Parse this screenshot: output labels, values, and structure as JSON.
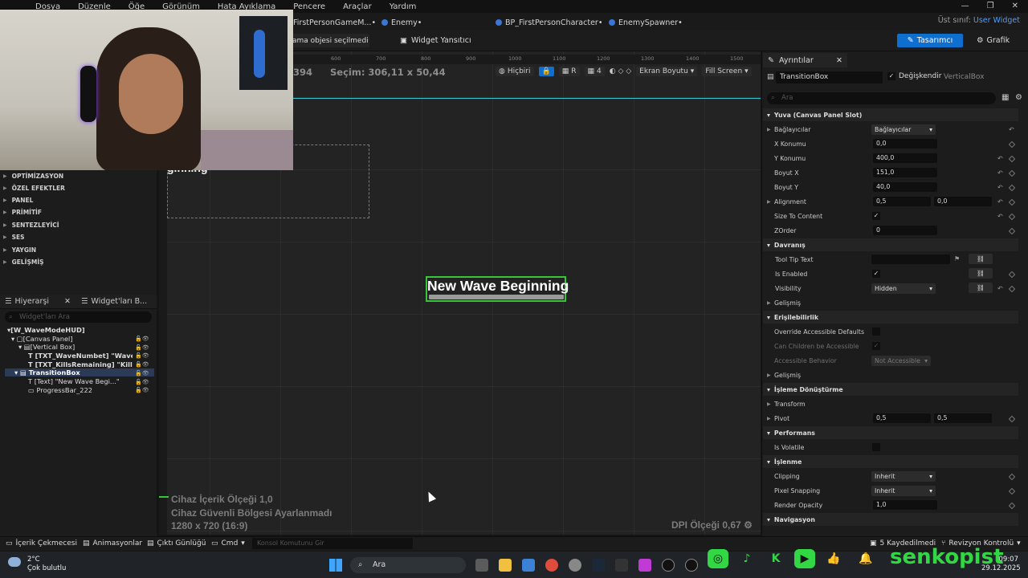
{
  "menu": [
    "Dosya",
    "Düzenle",
    "Öğe",
    "Görünüm",
    "Hata Ayıklama",
    "Pencere",
    "Araçlar",
    "Yardım"
  ],
  "tabs": [
    {
      "label": "FirstPersonGameM...•"
    },
    {
      "label": "Enemy•"
    },
    {
      "label": "BP_FirstPersonCharacter•"
    },
    {
      "label": "EnemySpawner•"
    }
  ],
  "parent_class": {
    "label": "Üst sınıf:",
    "value": "User Widget"
  },
  "toolbar": {
    "debug_dropdown": "ama objesi seçilmedi",
    "widget_reflector": "Widget Yansıtıcı",
    "designer": "Tasarımcı",
    "graph": "Grafik"
  },
  "palette_categories": [
    "OPTİMİZASYON",
    "ÖZEL EFEKTLER",
    "PANEL",
    "PRİMİTİF",
    "SENTEZLEYİCİ",
    "SES",
    "YAYGIN",
    "GELİŞMİŞ"
  ],
  "hierarchy": {
    "tab_hierarchy": "Hiyerarşi",
    "tab_library": "Widget'ları B...",
    "search_placeholder": "Widget'ları Ara",
    "items": [
      "[W_WaveModeHUD]",
      "[Canvas Panel]",
      "[Vertical Box]",
      "[TXT_WaveNumbet] \"Wave Num",
      "[TXT_KillsRemaining] \"KillsRema",
      "TransitionBox",
      "[Text] \"New Wave Begi...\"",
      "ProgressBar_222"
    ]
  },
  "ruler_ticks": [
    "600",
    "700",
    "800",
    "900",
    "1000",
    "1100",
    "1200",
    "1300",
    "1400",
    "1500"
  ],
  "viewport": {
    "selection_prefix": "394",
    "selection": "Seçim: 306,11 x 50,44",
    "none_btn": "Hiçbiri",
    "r_btn": "R",
    "grid_num": "4",
    "screen_size": "Ekran Boyutu",
    "fill_screen": "Fill Screen",
    "wave_text_partial": "ginning",
    "new_wave_text": "New Wave Beginning",
    "info_lines": [
      "Cihaz İçerik Ölçeği 1,0",
      "Cihaz Güvenli Bölgesi Ayarlanmadı",
      "1280 x 720 (16:9)"
    ],
    "dpi": "DPI Ölçeği 0,67"
  },
  "details": {
    "tab": "Ayrıntılar",
    "name": "TransitionBox",
    "variable_label": "Değişkendir",
    "type_label": "VerticalBox",
    "search_placeholder": "Ara",
    "sections": {
      "slot": "Yuva (Canvas Panel Slot)",
      "behavior": "Davranış",
      "accessibility": "Erişilebilirlik",
      "render_transform": "İşleme Dönüştürme",
      "performance": "Performans",
      "rendering": "İşlenme",
      "navigation": "Navigasyon"
    },
    "props": {
      "anchors": "Bağlayıcılar",
      "anchors_val": "Bağlayıcılar",
      "pos_x": "X Konumu",
      "pos_x_val": "0,0",
      "pos_y": "Y Konumu",
      "pos_y_val": "400,0",
      "size_x": "Boyut X",
      "size_x_val": "151,0",
      "size_y": "Boyut Y",
      "size_y_val": "40,0",
      "alignment": "Alignment",
      "alignment_x": "0,5",
      "alignment_y": "0,0",
      "size_to_content": "Size To Content",
      "zorder": "ZOrder",
      "zorder_val": "0",
      "tooltip": "Tool Tip Text",
      "is_enabled": "Is Enabled",
      "visibility": "Visibility",
      "visibility_val": "Hidden",
      "advanced": "Gelişmiş",
      "override_acc": "Override Accessible Defaults",
      "can_children": "Can Children be Accessible",
      "acc_behavior": "Accessible Behavior",
      "acc_behavior_val": "Not Accessible",
      "advanced2": "Gelişmiş",
      "transform": "Transform",
      "pivot": "Pivot",
      "pivot_x": "0,5",
      "pivot_y": "0,5",
      "is_volatile": "Is Volatile",
      "clipping": "Clipping",
      "clipping_val": "Inherit",
      "pixel_snapping": "Pixel Snapping",
      "pixel_snapping_val": "Inherit",
      "render_opacity": "Render Opacity",
      "render_opacity_val": "1,0"
    }
  },
  "bottombar": {
    "content_drawer": "İçerik Çekmecesi",
    "animations": "Animasyonlar",
    "output_log": "Çıktı Günlüğü",
    "cmd": "Cmd",
    "console_placeholder": "Konsol Komutunu Gir",
    "saved": "5 Kaydedilmedi",
    "revision": "Revizyon Kontrolü"
  },
  "taskbar": {
    "temp": "2°C",
    "weather": "Çok bulutlu",
    "search": "Ara",
    "time": "09:07",
    "date": "29.12.2025"
  },
  "overlay": {
    "brand": "senkopist"
  },
  "colors": {
    "accent": "#0f6fcf",
    "selection_green": "#37c63a",
    "brand_green": "#31d843"
  }
}
